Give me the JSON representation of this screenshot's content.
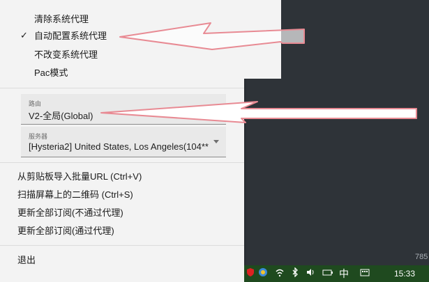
{
  "submenu": {
    "items": [
      {
        "label": "清除系统代理",
        "checked": false
      },
      {
        "label": "自动配置系统代理",
        "checked": true
      },
      {
        "label": "不改变系统代理",
        "checked": false
      },
      {
        "label": "Pac模式",
        "checked": false
      }
    ],
    "check_mark": "✓"
  },
  "route": {
    "label": "路由",
    "value": "V2-全局(Global)"
  },
  "server": {
    "label": "服务器",
    "value": "[Hysteria2] United States, Los Angeles(104**"
  },
  "actions": [
    "从剪贴板导入批量URL (Ctrl+V)",
    "扫描屏幕上的二维码 (Ctrl+S)",
    "更新全部订阅(不通过代理)",
    "更新全部订阅(通过代理)"
  ],
  "exit_label": "退出",
  "taskbar": {
    "time": "15:33",
    "ime_label": "中",
    "side_number": "785"
  },
  "colors": {
    "annotation_arrow": "#e88a93",
    "menu_bg": "#f3f3f3",
    "desktop_bg": "#2e3338"
  }
}
